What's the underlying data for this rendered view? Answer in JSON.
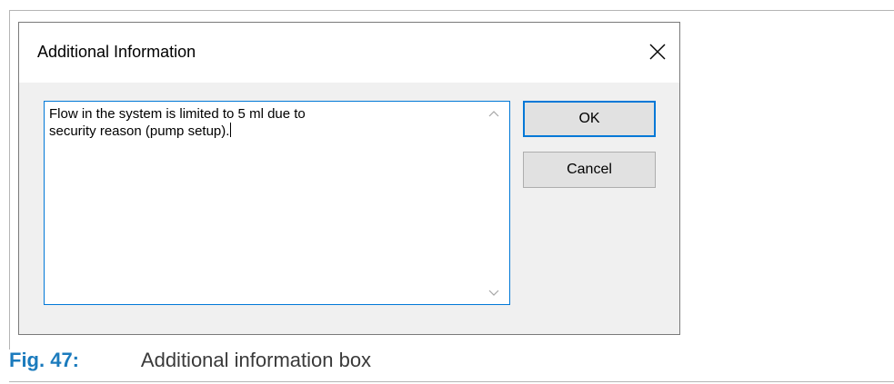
{
  "dialog": {
    "title": "Additional Information",
    "close_icon": "close-icon",
    "textarea_value": "Flow in the system is limited to 5 ml due to\nsecurity reason (pump setup).",
    "scroll_up_icon": "chevron-up-icon",
    "scroll_down_icon": "chevron-down-icon",
    "ok_label": "OK",
    "cancel_label": "Cancel"
  },
  "caption": {
    "label": "Fig. 47:",
    "text": "Additional information box"
  },
  "colors": {
    "accent": "#0078d7",
    "caption_label": "#1b7bbd",
    "dialog_background": "#f0f0f0"
  }
}
